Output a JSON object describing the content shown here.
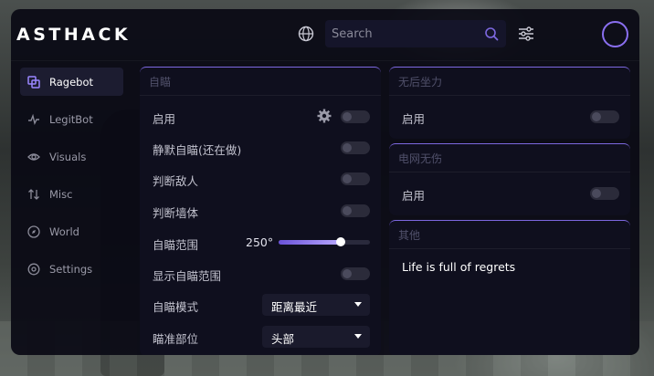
{
  "app": {
    "logo_text": "ASTHACK"
  },
  "header": {
    "search_placeholder": "Search",
    "icons": [
      "globe-icon",
      "search-icon",
      "sliders-icon",
      "avatar"
    ]
  },
  "sidebar": {
    "items": [
      {
        "label": "Ragebot",
        "icon": "layers-icon",
        "active": true
      },
      {
        "label": "LegitBot",
        "icon": "pulse-icon",
        "active": false
      },
      {
        "label": "Visuals",
        "icon": "eye-icon",
        "active": false
      },
      {
        "label": "Misc",
        "icon": "arrows-icon",
        "active": false
      },
      {
        "label": "World",
        "icon": "compass-icon",
        "active": false
      },
      {
        "label": "Settings",
        "icon": "gear-icon",
        "active": false
      }
    ]
  },
  "aimbot_panel": {
    "title": "自瞄",
    "enable_label": "启用",
    "silent_label": "静默自瞄(还在做)",
    "enemy_label": "判断敌人",
    "wall_label": "判断墙体",
    "range_label": "自瞄范围",
    "range_value": "250°",
    "range_level": 0.68,
    "show_range_label": "显示自瞄范围",
    "mode_label": "自瞄模式",
    "mode_value": "距离最近",
    "target_label": "瞄准部位",
    "target_value": "头部"
  },
  "norecoil_panel": {
    "title": "无后坐力",
    "enable_label": "启用"
  },
  "godmode_panel": {
    "title": "电网无伤",
    "enable_label": "启用"
  },
  "other_panel": {
    "title": "其他",
    "text": "Life is full of regrets"
  },
  "colors": {
    "accent": "#7d68e0",
    "background": "#0a0a14",
    "panel": "#0f0f1e"
  }
}
